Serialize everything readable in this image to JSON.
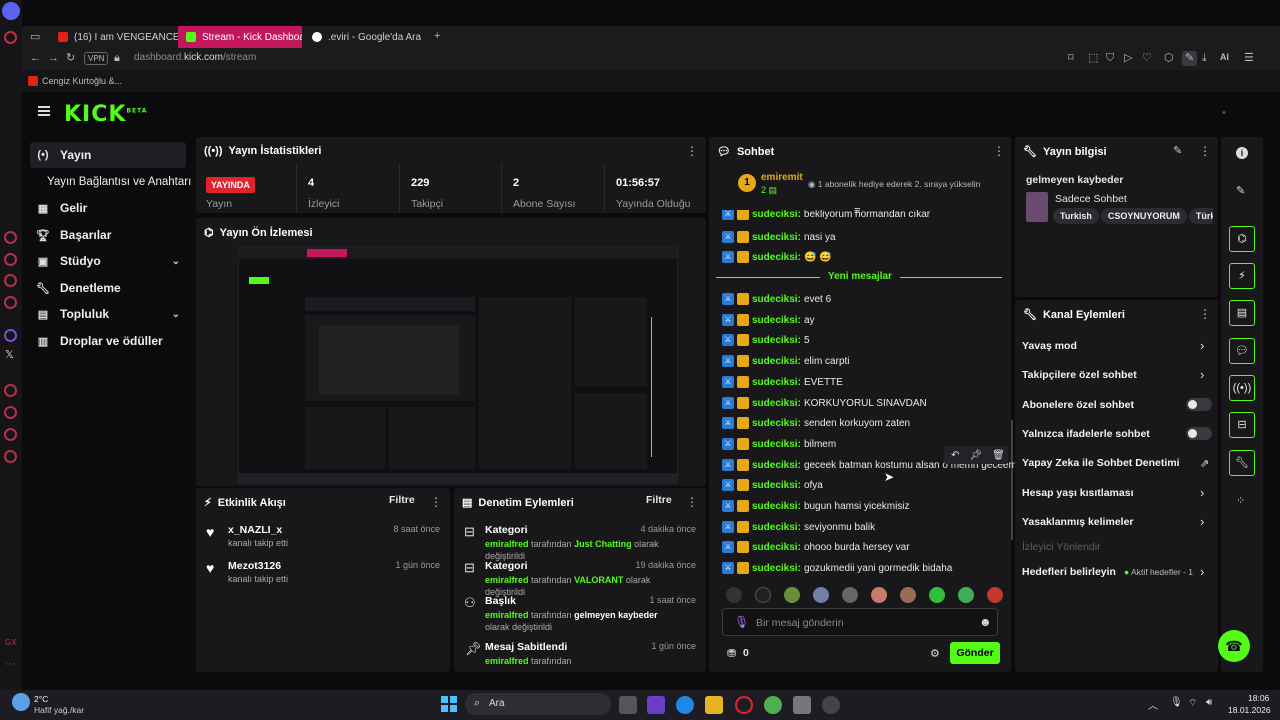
{
  "browser": {
    "tabs": [
      {
        "label": "(16) I am VENGEANCE. I am...",
        "icon": "youtube-icon"
      },
      {
        "label": "Stream - Kick Dashboard",
        "icon": "kick-icon"
      },
      {
        "label": ".eviri - Google'da Ara",
        "icon": "google-icon"
      }
    ],
    "vpn": "VPN",
    "url_prefix": "dashboard.",
    "url_domain": "kick.com",
    "url_path": "/stream",
    "bookmark": "Cengiz Kurtoğlu &...",
    "ai_label": "AI"
  },
  "sidebar": {
    "items": [
      {
        "label": "Yayın",
        "icon": "broadcast-icon"
      },
      {
        "label": "Yayın Bağlantısı ve Anahtarı",
        "icon": ""
      },
      {
        "label": "Gelir",
        "icon": "revenue-icon"
      },
      {
        "label": "Başarılar",
        "icon": "trophy-icon"
      },
      {
        "label": "Stüdyo",
        "icon": "studio-icon"
      },
      {
        "label": "Denetleme",
        "icon": "wrench-icon"
      },
      {
        "label": "Topluluk",
        "icon": "community-icon"
      },
      {
        "label": "Droplar ve ödüller",
        "icon": "drops-icon"
      }
    ]
  },
  "stats": {
    "title": "Yayın İstatistikleri",
    "live": "YAYINDA",
    "items": [
      {
        "value": "",
        "label": "Yayın"
      },
      {
        "value": "4",
        "label": "İzleyici"
      },
      {
        "value": "229",
        "label": "Takipçi"
      },
      {
        "value": "2",
        "label": "Abone Sayısı"
      },
      {
        "value": "01:56:57",
        "label": "Yayında Olduğu Süre"
      }
    ]
  },
  "preview": {
    "title": "Yayın Ön İzlemesi"
  },
  "activity": {
    "title": "Etkinlik Akışı",
    "filter": "Filtre",
    "items": [
      {
        "name": "x_NAZLI_x",
        "sub": "kanalı takip etti",
        "ago": "8 saat önce"
      },
      {
        "name": "Mezot3126",
        "sub": "kanalı takip etti",
        "ago": "1 gün önce"
      }
    ]
  },
  "moderation": {
    "title": "Denetim Eylemleri",
    "filter": "Filtre",
    "items": [
      {
        "title": "Kategori",
        "user": "emiralfred",
        "mid": " tarafından ",
        "value": "Just Chatting",
        "end": " olarak değiştirildi",
        "ago": "4 dakika önce"
      },
      {
        "title": "Kategori",
        "user": "emiralfred",
        "mid": " tarafından ",
        "value": "VALORANT",
        "end": " olarak değiştirildi",
        "ago": "19 dakika önce"
      },
      {
        "title": "Başlık",
        "user": "emiralfred",
        "mid": " tarafından ",
        "value": "gelmeyen kaybeder",
        "end": " olarak değiştirildi",
        "ago": "1 saat önce"
      },
      {
        "title": "Mesaj Sabitlendi",
        "user": "emiralfred",
        "mid": " tarafından",
        "value": "",
        "end": "",
        "ago": "1 gün önce"
      }
    ]
  },
  "chat": {
    "title": "Sohbet",
    "pinned_user": "emiremit",
    "pinned_rank": "1",
    "pinned_count": "2",
    "pinned_text": "1 abonelik hediye ederek 2. sıraya yükselin",
    "cut_message": "bekliyorum hormandan cıkar",
    "new_messages": "Yeni mesajlar",
    "messages": [
      {
        "user": "sudeciksi",
        "text": "nasi ya"
      },
      {
        "user": "sudeciksi",
        "text": "😅 😅"
      },
      {
        "user": "sudeciksi",
        "text": "evet 6"
      },
      {
        "user": "sudeciksi",
        "text": "ay"
      },
      {
        "user": "sudeciksi",
        "text": "5"
      },
      {
        "user": "sudeciksi",
        "text": "elim carpti"
      },
      {
        "user": "sudeciksi",
        "text": "EVETTE"
      },
      {
        "user": "sudeciksi",
        "text": "KORKUYORUL SINAVDAN"
      },
      {
        "user": "sudeciksi",
        "text": "senden korkuyom zaten"
      },
      {
        "user": "sudeciksi",
        "text": "bilmem"
      },
      {
        "user": "sudeciksi",
        "text": "geceek batman kostumu alsan o memn geceem"
      },
      {
        "user": "sudeciksi",
        "text": "ofya"
      },
      {
        "user": "sudeciksi",
        "text": "bugun hamsi yicekmisiz"
      },
      {
        "user": "sudeciksi",
        "text": "seviyonmu balik"
      },
      {
        "user": "sudeciksi",
        "text": "ohooo burda hersey var"
      },
      {
        "user": "sudeciksi",
        "text": "gozukmedii yani gormedik bidaha"
      }
    ],
    "placeholder": "Bir mesaj gönderin",
    "points": "0",
    "send": "Gönder"
  },
  "info": {
    "title": "Yayın bilgisi",
    "stream_title": "gelmeyen kaybeder",
    "category": "Sadece Sohbet",
    "tags": [
      "Turkish",
      "CSOYNUYORUM",
      "Türkç"
    ]
  },
  "channel_actions": {
    "title": "Kanal Eylemleri",
    "items": [
      {
        "label": "Yavaş mod",
        "control": "arrow"
      },
      {
        "label": "Takipçilere özel sohbet",
        "control": "arrow"
      },
      {
        "label": "Abonelere özel sohbet",
        "control": "toggle"
      },
      {
        "label": "Yalnızca ifadelerle sohbet",
        "control": "toggle"
      },
      {
        "label": "Yapay Zeka ile Sohbet Denetimi",
        "control": "external"
      },
      {
        "label": "Hesap yaşı kısıtlaması",
        "control": "arrow"
      },
      {
        "label": "Yasaklanmış kelimeler",
        "control": "arrow"
      },
      {
        "label": "İzleyici Yönlendir",
        "control": "disabled"
      },
      {
        "label": "Hedefleri belirleyin",
        "control": "arrow"
      }
    ],
    "goals_status": "Aktif hedefler - 1"
  },
  "taskbar": {
    "temp": "2°C",
    "weather": "Hafif yağ./kar",
    "search": "Ara",
    "time": "18:06",
    "date": "18.01.2026"
  },
  "colors": {
    "accent": "#53fc18",
    "live": "#e0232d",
    "tab_active": "#c2185b"
  }
}
